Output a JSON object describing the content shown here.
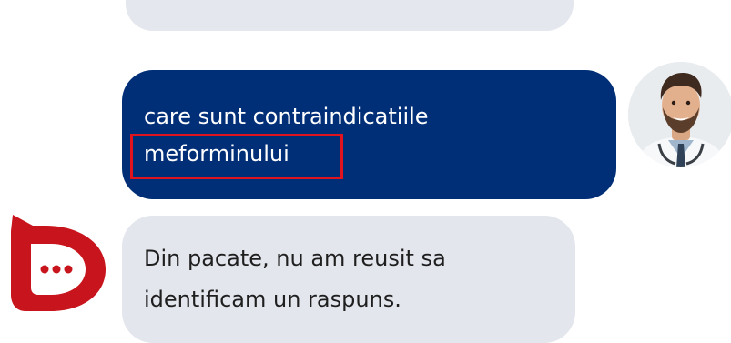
{
  "chat": {
    "user_message": {
      "line1": "care sunt contraindicatiile",
      "line2": "meforminului"
    },
    "bot_message": {
      "line1": "Din pacate, nu am reusit sa",
      "line2": "identificam un raspuns."
    }
  },
  "colors": {
    "user_bubble": "#002f77",
    "bot_bubble": "#e3e6ed",
    "highlight": "#e0141e",
    "logo": "#c8141c"
  },
  "icons": {
    "user_avatar": "doctor-avatar",
    "bot_logo": "chat-bot-logo-icon"
  }
}
